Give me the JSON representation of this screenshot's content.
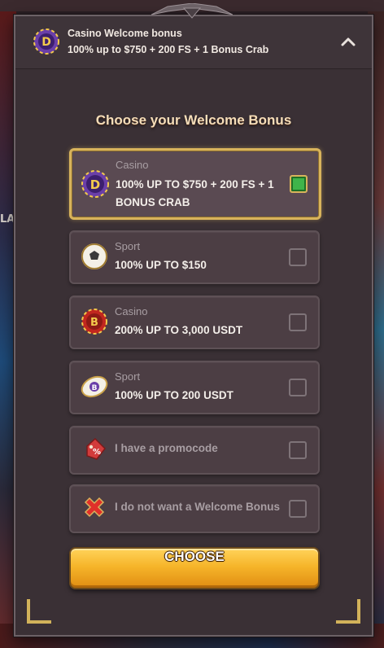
{
  "background": {
    "cut_label": "LAI"
  },
  "header": {
    "title": "Casino Welcome bonus",
    "subtitle": "100% up to $750 + 200 FS + 1 Bonus Crab",
    "logo_icon": "casino-chip-icon",
    "collapse_icon": "chevron-up-icon"
  },
  "heading": "Choose your Welcome Bonus",
  "options": [
    {
      "category": "Casino",
      "value": "100% UP TO $750 + 200 FS + 1 BONUS CRAB",
      "icon": "casino-chip-icon",
      "selected": true
    },
    {
      "category": "Sport",
      "value": "100% UP TO $150",
      "icon": "soccer-ball-icon",
      "selected": false
    },
    {
      "category": "Casino",
      "value": "200% UP TO 3,000 USDT",
      "icon": "bitcoin-chip-icon",
      "selected": false
    },
    {
      "category": "Sport",
      "value": "100% UP TO 200 USDT",
      "icon": "bitcoin-rugby-ball-icon",
      "selected": false
    },
    {
      "label": "I have a promocode",
      "icon": "price-tag-icon",
      "selected": false
    },
    {
      "label": "I do not want a Welcome Bonus",
      "icon": "red-cross-icon",
      "selected": false
    }
  ],
  "choose_button": "CHOOSE",
  "colors": {
    "accent_gold": "#d8b35c",
    "check_green": "#3fb44a",
    "panel": "#3a3035"
  }
}
